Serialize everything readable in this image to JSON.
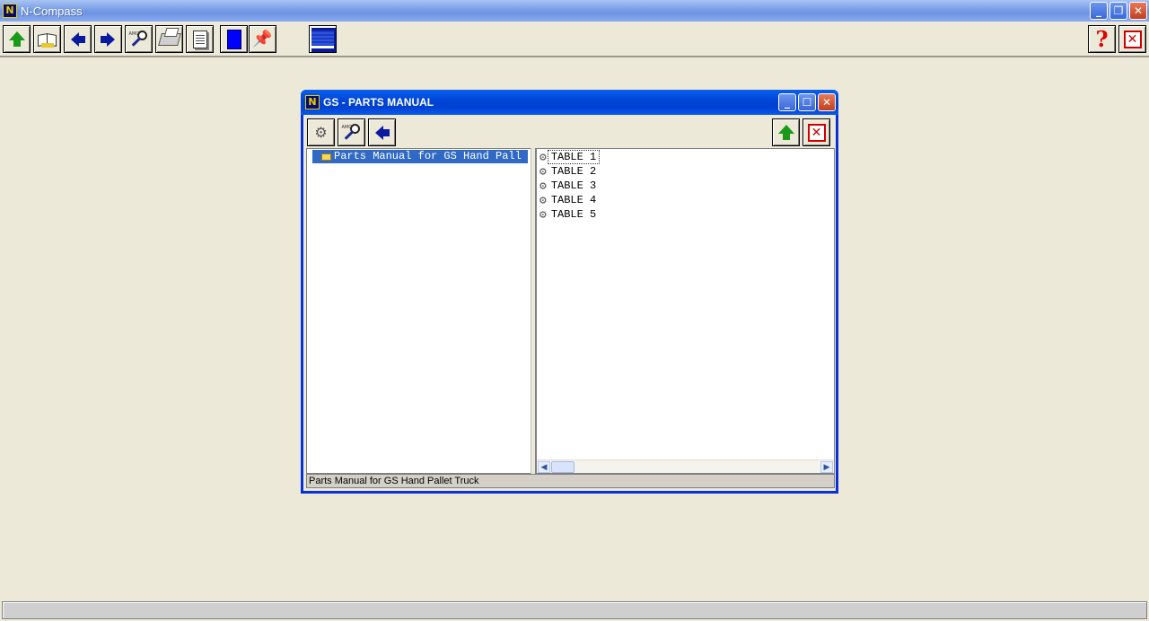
{
  "app": {
    "title": "N-Compass",
    "icon_letter": "N"
  },
  "main_toolbar": {
    "buttons": [
      {
        "name": "up-button",
        "icon": "up-arrow-icon"
      },
      {
        "name": "open-book-button",
        "icon": "open-book-icon"
      },
      {
        "name": "back-button",
        "icon": "left-arrow-icon"
      },
      {
        "name": "forward-button",
        "icon": "right-arrow-icon"
      },
      {
        "name": "zoom-button",
        "icon": "magnifier-icon"
      },
      {
        "name": "print-button",
        "icon": "printer-icon"
      },
      {
        "name": "notes-button",
        "icon": "clipboard-icon"
      },
      {
        "name": "bookmark-button",
        "icon": "blue-page-icon"
      },
      {
        "name": "pin-button",
        "icon": "pin-icon"
      },
      {
        "name": "display-button",
        "icon": "monitor-icon"
      },
      {
        "name": "help-button",
        "icon": "question-mark-icon"
      },
      {
        "name": "exit-button",
        "icon": "close-x-icon"
      }
    ],
    "magnifier_text": "AMO"
  },
  "child_window": {
    "title": "GS - PARTS MANUAL",
    "tree": {
      "items": [
        {
          "label": "Parts Manual for GS Hand Pall",
          "selected": true
        }
      ]
    },
    "list": {
      "items": [
        {
          "label": "TABLE 1",
          "focused": true
        },
        {
          "label": "TABLE 2"
        },
        {
          "label": "TABLE 3"
        },
        {
          "label": "TABLE 4"
        },
        {
          "label": "TABLE 5"
        }
      ]
    },
    "status_text": "Parts Manual for GS Hand Pallet Truck"
  },
  "colors": {
    "selection": "#316ac5",
    "titlebar_active": "#0046d8",
    "arrow_green": "#1a9a1a",
    "arrow_blue": "#0a1aa0",
    "close_red": "#d00000"
  }
}
